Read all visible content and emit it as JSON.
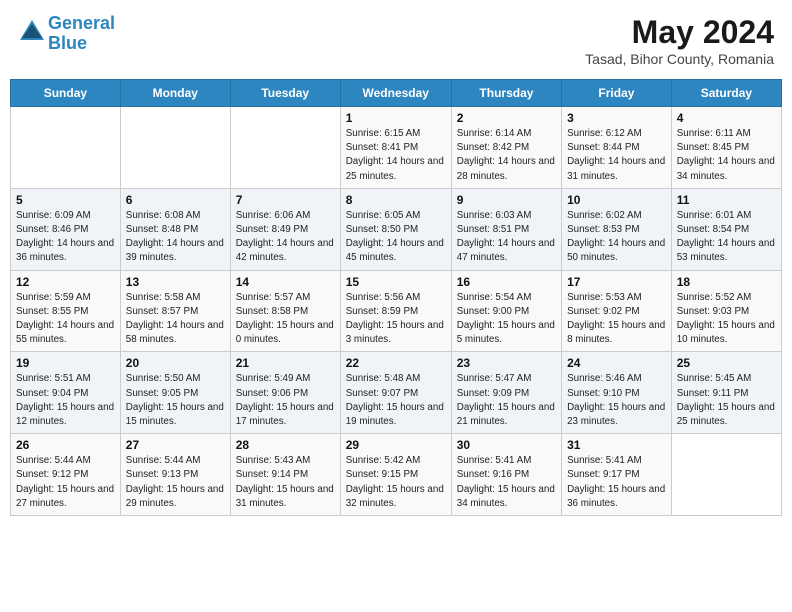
{
  "header": {
    "logo_line1": "General",
    "logo_line2": "Blue",
    "main_title": "May 2024",
    "subtitle": "Tasad, Bihor County, Romania"
  },
  "days_of_week": [
    "Sunday",
    "Monday",
    "Tuesday",
    "Wednesday",
    "Thursday",
    "Friday",
    "Saturday"
  ],
  "weeks": [
    [
      {
        "day": "",
        "info": ""
      },
      {
        "day": "",
        "info": ""
      },
      {
        "day": "",
        "info": ""
      },
      {
        "day": "1",
        "info": "Sunrise: 6:15 AM\nSunset: 8:41 PM\nDaylight: 14 hours and 25 minutes."
      },
      {
        "day": "2",
        "info": "Sunrise: 6:14 AM\nSunset: 8:42 PM\nDaylight: 14 hours and 28 minutes."
      },
      {
        "day": "3",
        "info": "Sunrise: 6:12 AM\nSunset: 8:44 PM\nDaylight: 14 hours and 31 minutes."
      },
      {
        "day": "4",
        "info": "Sunrise: 6:11 AM\nSunset: 8:45 PM\nDaylight: 14 hours and 34 minutes."
      }
    ],
    [
      {
        "day": "5",
        "info": "Sunrise: 6:09 AM\nSunset: 8:46 PM\nDaylight: 14 hours and 36 minutes."
      },
      {
        "day": "6",
        "info": "Sunrise: 6:08 AM\nSunset: 8:48 PM\nDaylight: 14 hours and 39 minutes."
      },
      {
        "day": "7",
        "info": "Sunrise: 6:06 AM\nSunset: 8:49 PM\nDaylight: 14 hours and 42 minutes."
      },
      {
        "day": "8",
        "info": "Sunrise: 6:05 AM\nSunset: 8:50 PM\nDaylight: 14 hours and 45 minutes."
      },
      {
        "day": "9",
        "info": "Sunrise: 6:03 AM\nSunset: 8:51 PM\nDaylight: 14 hours and 47 minutes."
      },
      {
        "day": "10",
        "info": "Sunrise: 6:02 AM\nSunset: 8:53 PM\nDaylight: 14 hours and 50 minutes."
      },
      {
        "day": "11",
        "info": "Sunrise: 6:01 AM\nSunset: 8:54 PM\nDaylight: 14 hours and 53 minutes."
      }
    ],
    [
      {
        "day": "12",
        "info": "Sunrise: 5:59 AM\nSunset: 8:55 PM\nDaylight: 14 hours and 55 minutes."
      },
      {
        "day": "13",
        "info": "Sunrise: 5:58 AM\nSunset: 8:57 PM\nDaylight: 14 hours and 58 minutes."
      },
      {
        "day": "14",
        "info": "Sunrise: 5:57 AM\nSunset: 8:58 PM\nDaylight: 15 hours and 0 minutes."
      },
      {
        "day": "15",
        "info": "Sunrise: 5:56 AM\nSunset: 8:59 PM\nDaylight: 15 hours and 3 minutes."
      },
      {
        "day": "16",
        "info": "Sunrise: 5:54 AM\nSunset: 9:00 PM\nDaylight: 15 hours and 5 minutes."
      },
      {
        "day": "17",
        "info": "Sunrise: 5:53 AM\nSunset: 9:02 PM\nDaylight: 15 hours and 8 minutes."
      },
      {
        "day": "18",
        "info": "Sunrise: 5:52 AM\nSunset: 9:03 PM\nDaylight: 15 hours and 10 minutes."
      }
    ],
    [
      {
        "day": "19",
        "info": "Sunrise: 5:51 AM\nSunset: 9:04 PM\nDaylight: 15 hours and 12 minutes."
      },
      {
        "day": "20",
        "info": "Sunrise: 5:50 AM\nSunset: 9:05 PM\nDaylight: 15 hours and 15 minutes."
      },
      {
        "day": "21",
        "info": "Sunrise: 5:49 AM\nSunset: 9:06 PM\nDaylight: 15 hours and 17 minutes."
      },
      {
        "day": "22",
        "info": "Sunrise: 5:48 AM\nSunset: 9:07 PM\nDaylight: 15 hours and 19 minutes."
      },
      {
        "day": "23",
        "info": "Sunrise: 5:47 AM\nSunset: 9:09 PM\nDaylight: 15 hours and 21 minutes."
      },
      {
        "day": "24",
        "info": "Sunrise: 5:46 AM\nSunset: 9:10 PM\nDaylight: 15 hours and 23 minutes."
      },
      {
        "day": "25",
        "info": "Sunrise: 5:45 AM\nSunset: 9:11 PM\nDaylight: 15 hours and 25 minutes."
      }
    ],
    [
      {
        "day": "26",
        "info": "Sunrise: 5:44 AM\nSunset: 9:12 PM\nDaylight: 15 hours and 27 minutes."
      },
      {
        "day": "27",
        "info": "Sunrise: 5:44 AM\nSunset: 9:13 PM\nDaylight: 15 hours and 29 minutes."
      },
      {
        "day": "28",
        "info": "Sunrise: 5:43 AM\nSunset: 9:14 PM\nDaylight: 15 hours and 31 minutes."
      },
      {
        "day": "29",
        "info": "Sunrise: 5:42 AM\nSunset: 9:15 PM\nDaylight: 15 hours and 32 minutes."
      },
      {
        "day": "30",
        "info": "Sunrise: 5:41 AM\nSunset: 9:16 PM\nDaylight: 15 hours and 34 minutes."
      },
      {
        "day": "31",
        "info": "Sunrise: 5:41 AM\nSunset: 9:17 PM\nDaylight: 15 hours and 36 minutes."
      },
      {
        "day": "",
        "info": ""
      }
    ]
  ]
}
